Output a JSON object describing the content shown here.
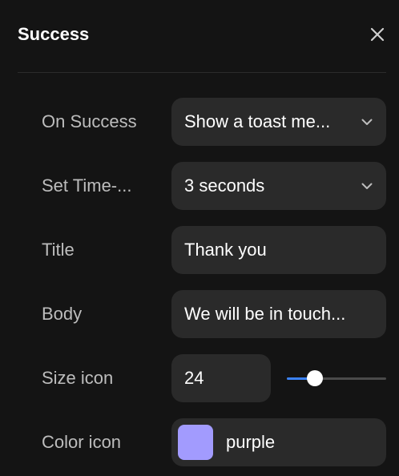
{
  "panel": {
    "title": "Success",
    "close_icon": "close-icon"
  },
  "rows": {
    "on_success": {
      "label": "On Success",
      "value": "Show a toast me...",
      "icon": "chevron-down-icon"
    },
    "timeout": {
      "label": "Set Time-...",
      "value": "3 seconds",
      "icon": "chevron-down-icon"
    },
    "title": {
      "label": "Title",
      "value": "Thank you"
    },
    "body": {
      "label": "Body",
      "value": "We will be in touch..."
    },
    "size_icon": {
      "label": "Size icon",
      "value": "24",
      "slider_fraction": 0.28
    },
    "color_icon": {
      "label": "Color icon",
      "value": "purple",
      "swatch_color": "#a29bfe"
    }
  },
  "colors": {
    "background": "#141414",
    "field": "#2a2a2a",
    "accent": "#3b82f6",
    "label": "#bdbdbd"
  }
}
